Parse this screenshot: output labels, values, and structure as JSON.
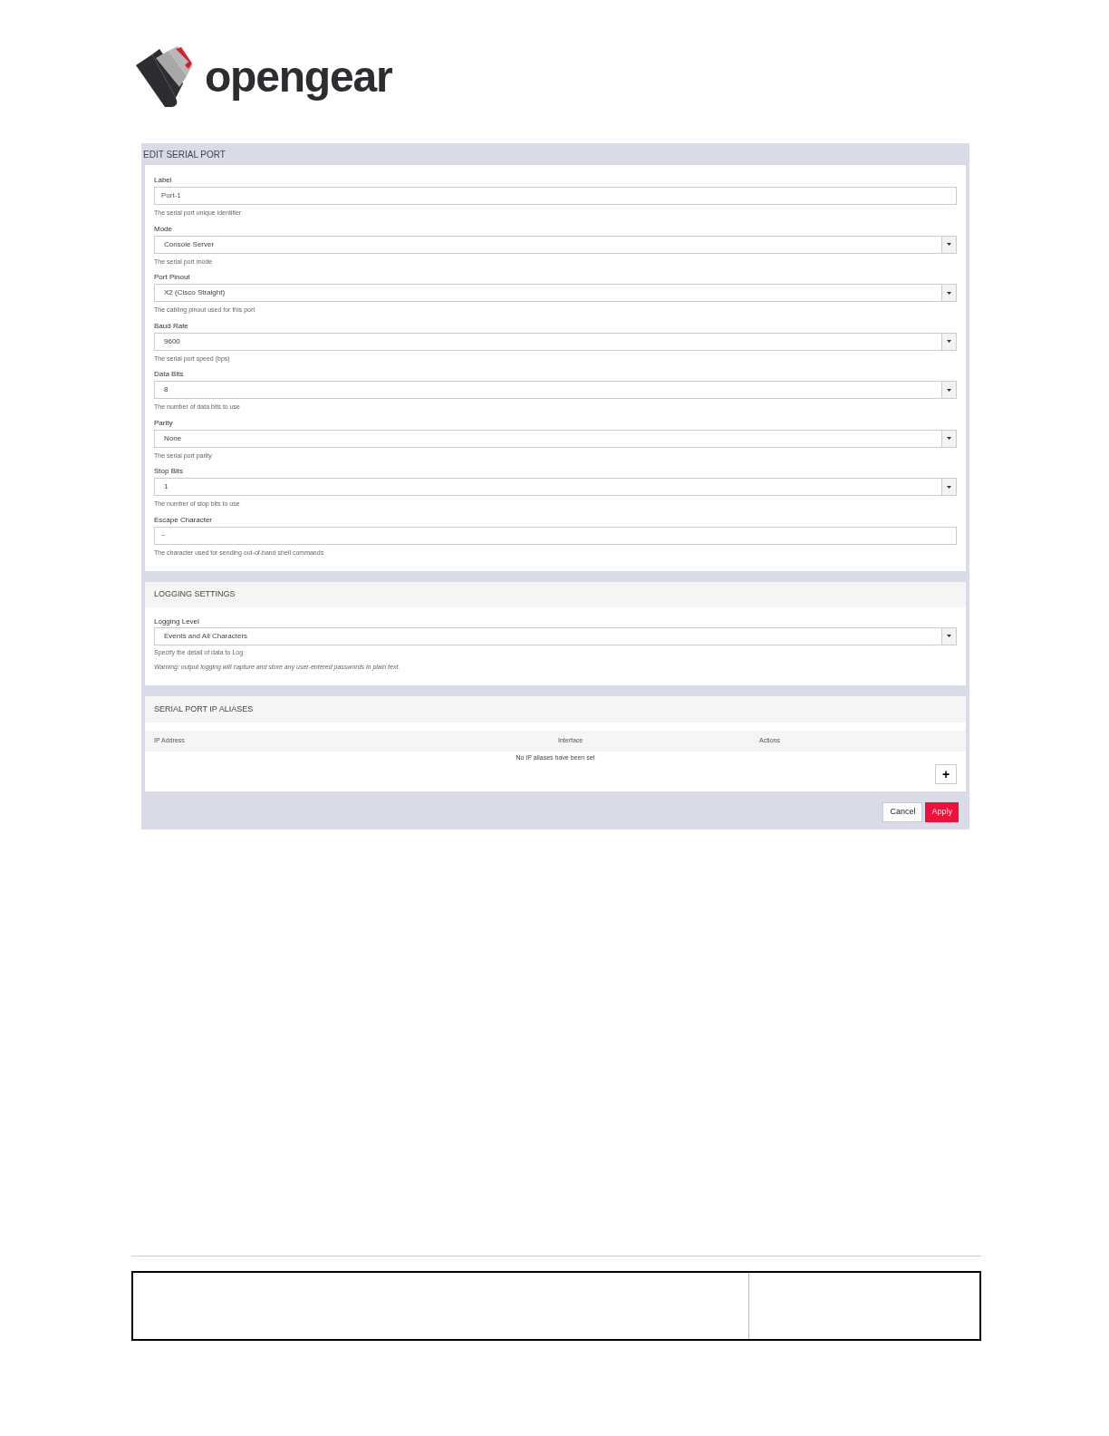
{
  "logo": {
    "text": "opengear"
  },
  "dialog": {
    "title": "EDIT SERIAL PORT",
    "fields": [
      {
        "kind": "text",
        "label": "Label",
        "value": "Port-1",
        "help": "The serial port unique identifier"
      },
      {
        "kind": "select",
        "label": "Mode",
        "value": "Console Server",
        "help": "The serial port mode"
      },
      {
        "kind": "select",
        "label": "Port Pinout",
        "value": "X2 (Cisco Straight)",
        "help": "The cabling pinout used for this port"
      },
      {
        "kind": "select",
        "label": "Baud Rate",
        "value": "9600",
        "help": "The serial port speed (bps)"
      },
      {
        "kind": "select",
        "label": "Data Bits",
        "value": "8",
        "help": "The number of data bits to use"
      },
      {
        "kind": "select",
        "label": "Parity",
        "value": "None",
        "help": "The serial port parity"
      },
      {
        "kind": "select",
        "label": "Stop Bits",
        "value": "1",
        "help": "The number of stop bits to use"
      },
      {
        "kind": "text",
        "label": "Escape Character",
        "value": "~",
        "help": "The character used for sending out-of-band shell commands"
      }
    ],
    "logging": {
      "title": "LOGGING SETTINGS",
      "label": "Logging Level",
      "value": "Events and All Characters",
      "help": "Specify the detail of data to Log",
      "warning": "Warning: output logging will capture and store any user-entered passwords in plain text."
    },
    "aliases": {
      "title": "SERIAL PORT IP ALIASES",
      "columns": [
        "IP Address",
        "Interface",
        "Actions"
      ],
      "empty": "No IP aliases have been set",
      "add_button": "+"
    },
    "buttons": [
      {
        "kind": "secondary",
        "label": "Cancel"
      },
      {
        "kind": "primary",
        "label": "Apply"
      }
    ]
  }
}
